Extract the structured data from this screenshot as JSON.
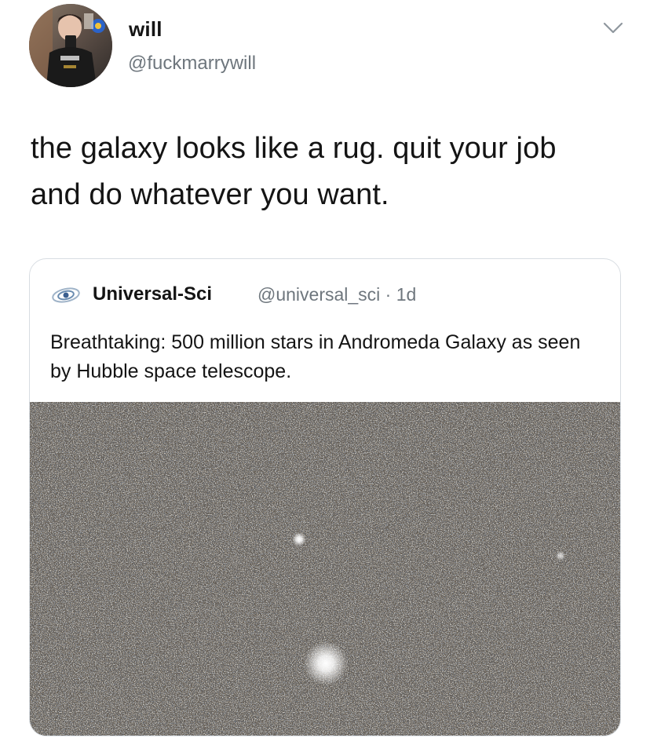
{
  "tweet": {
    "author_name": "will",
    "author_handle": "@fuckmarrywill",
    "text": "the galaxy looks like a rug. quit your job and do whatever you want.",
    "avatar_icon": "user-avatar-photo",
    "menu_icon": "chevron-down-icon"
  },
  "quoted_tweet": {
    "author_name": "Universal-Sci",
    "author_handle": "@universal_sci · 1d",
    "text": "Breathtaking: 500 million stars in Andromeda Galaxy as seen by Hubble space telescope.",
    "logo_icon": "galaxy-logo-icon"
  },
  "colors": {
    "text_primary": "#141414",
    "text_secondary": "#6e767d",
    "border": "#d8dde2"
  }
}
